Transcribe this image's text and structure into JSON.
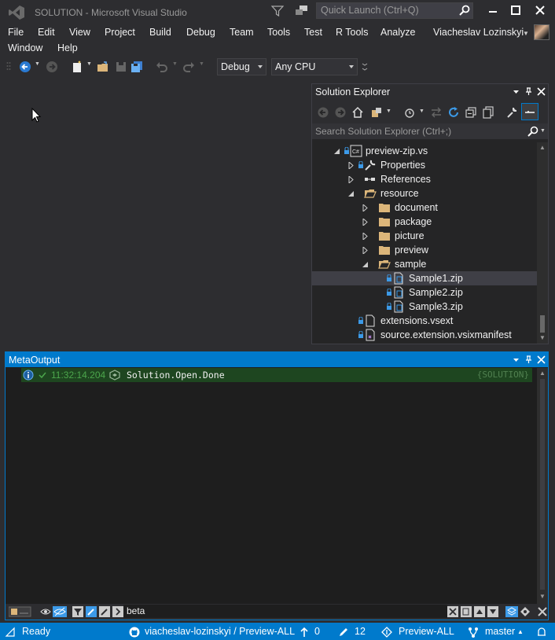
{
  "titlebar": {
    "title": "SOLUTION - Microsoft Visual Studio",
    "quick_launch_placeholder": "Quick Launch (Ctrl+Q)"
  },
  "menu": {
    "row1": [
      "File",
      "Edit",
      "View",
      "Project",
      "Build",
      "Debug",
      "Team",
      "Tools",
      "Test",
      "R Tools",
      "Analyze"
    ],
    "row2": [
      "Window",
      "Help"
    ],
    "user_name": "Viacheslav Lozinskyi"
  },
  "toolbar": {
    "configuration": "Debug",
    "platform": "Any CPU"
  },
  "solution_explorer": {
    "title": "Solution Explorer",
    "search_placeholder": "Search Solution Explorer (Ctrl+;)",
    "tree": [
      {
        "label": "preview-zip.vs",
        "icon": "csharp-project-icon"
      },
      {
        "label": "Properties",
        "icon": "wrench-icon"
      },
      {
        "label": "References",
        "icon": "references-icon"
      },
      {
        "label": "resource",
        "icon": "folder-open-icon"
      },
      {
        "label": "document",
        "icon": "folder-icon"
      },
      {
        "label": "package",
        "icon": "folder-icon"
      },
      {
        "label": "picture",
        "icon": "folder-icon"
      },
      {
        "label": "preview",
        "icon": "folder-icon"
      },
      {
        "label": "sample",
        "icon": "folder-open-icon"
      },
      {
        "label": "Sample1.zip",
        "icon": "zip-file-icon",
        "selected": true
      },
      {
        "label": "Sample2.zip",
        "icon": "zip-file-icon"
      },
      {
        "label": "Sample3.zip",
        "icon": "zip-file-icon"
      },
      {
        "label": "extensions.vsext",
        "icon": "file-icon"
      },
      {
        "label": "source.extension.vsixmanifest",
        "icon": "manifest-icon"
      }
    ]
  },
  "meta_output": {
    "title": "MetaOutput",
    "entries": [
      {
        "time": "11:32:14.204",
        "message": "Solution.Open.Done",
        "tag": "{SOLUTION}"
      }
    ],
    "filter_value": "beta"
  },
  "status_bar": {
    "state": "Ready",
    "repo": "viacheslav-lozinskyi / Preview-ALL",
    "unpushed": "0",
    "changes": "12",
    "project": "Preview-ALL",
    "branch": "master"
  },
  "colors": {
    "accent": "#007acc",
    "background": "#2d2d30",
    "tree_background": "#252526",
    "output_line": "#1e4620"
  }
}
